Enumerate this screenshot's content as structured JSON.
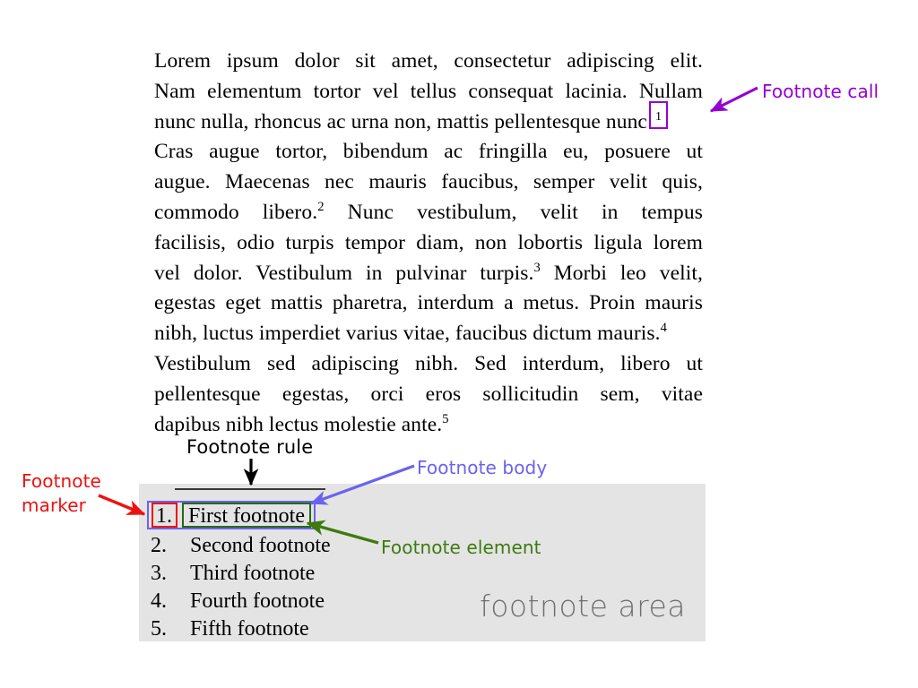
{
  "document": {
    "paragraph_lines": [
      "Lorem ipsum dolor sit amet, consectetur adipiscing elit.",
      "Nam elementum tortor vel tellus consequat lacinia. Nullam",
      "nunc nulla, rhoncus ac urna non, mattis pellentesque nunc",
      "Cras augue tortor, bibendum ac fringilla eu, posuere ut",
      "augue. Maecenas nec mauris faucibus, semper velit quis,",
      "commodo libero.",
      " Nunc vestibulum, velit in tempus",
      "facilisis, odio turpis tempor diam, non lobortis ligula lorem",
      "vel dolor. Vestibulum in pulvinar turpis.",
      " Morbi leo velit,",
      "egestas eget mattis pharetra, interdum a metus. Proin mauris",
      "nibh, luctus imperdiet varius vitae, faucibus dictum mauris.",
      "Vestibulum sed adipiscing nibh. Sed interdum, libero ut",
      "pellentesque egestas, orci eros sollicitudin sem, vitae",
      "dapibus nibh lectus molestie ante."
    ],
    "footnote_calls": {
      "call_1": "1",
      "call_2": "2",
      "call_3": "3",
      "call_4": "4",
      "call_5": "5"
    }
  },
  "footnote_area": {
    "label": "footnote area",
    "rule_present": true,
    "items": [
      {
        "marker": "1.",
        "text": "First footnote"
      },
      {
        "marker": "2.",
        "text": "Second footnote"
      },
      {
        "marker": "3.",
        "text": "Third footnote"
      },
      {
        "marker": "4.",
        "text": "Fourth footnote"
      },
      {
        "marker": "5.",
        "text": "Fifth footnote"
      }
    ]
  },
  "annotations": {
    "footnote_call": {
      "label": "Footnote call",
      "color": "#9400d3"
    },
    "footnote_rule": {
      "label": "Footnote rule",
      "color": "#000000"
    },
    "footnote_marker": {
      "label_line1": "Footnote",
      "label_line2": "marker",
      "color": "#ee1111"
    },
    "footnote_body": {
      "label": "Footnote body",
      "color": "#6a62ef"
    },
    "footnote_element": {
      "label": "Footnote element",
      "color": "#3d7a10"
    }
  },
  "colors": {
    "area_background": "#e4e4e4",
    "area_label": "#6f6f6f",
    "page_background": "#ffffff",
    "text": "#000000"
  }
}
